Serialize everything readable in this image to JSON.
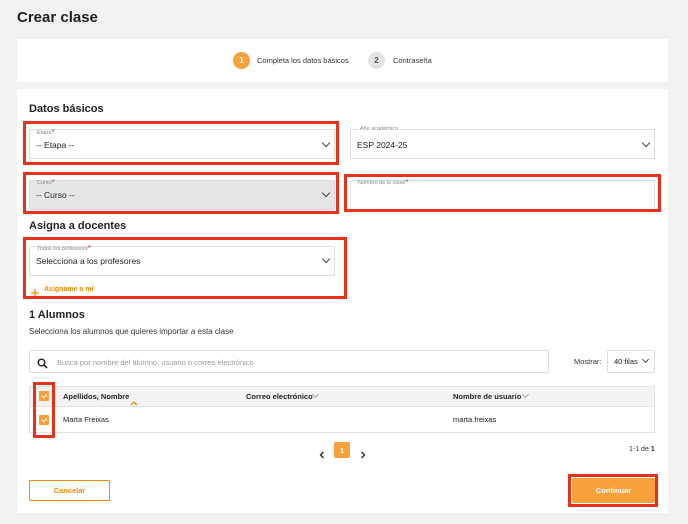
{
  "page": {
    "title": "Crear clase"
  },
  "stepper": {
    "step1": {
      "number": "1",
      "label": "Completa los datos básicos"
    },
    "step2": {
      "number": "2",
      "label": "Contraseña"
    }
  },
  "basic": {
    "title": "Datos básicos",
    "etapa": {
      "label": "Etapa",
      "value": "-- Etapa --"
    },
    "anio": {
      "label": "Año académico",
      "value": "ESP 2024-25"
    },
    "curso": {
      "label": "Curso",
      "value": "-- Curso --"
    },
    "nombre": {
      "label": "Nombre de la clase",
      "value": ""
    }
  },
  "teachers": {
    "title": "Asigna a docentes",
    "field_label": "Todos los profesores",
    "field_value": "Selecciona a los profesores",
    "assign_me": "Asígname a mí"
  },
  "students": {
    "title": "1 Alumnos",
    "subtitle": "Selecciona los alumnos que quieres importar a esta clase",
    "search_placeholder": "Busca por nombre del alumno, usuario o correo electrónico",
    "show_label": "Mostrar:",
    "rows_option": "40 filas",
    "columns": [
      "Apellidos, Nombre",
      "Correo electrónico",
      "Nombre de usuario"
    ],
    "rows": [
      {
        "name": "Marta Freixas",
        "email": "",
        "username": "marta.freixas"
      }
    ],
    "page_current": "1",
    "range_text": "1-1 de",
    "range_total": "1"
  },
  "actions": {
    "cancel": "Cancelar",
    "continue": "Continuar"
  },
  "colors": {
    "accent": "#f7a13a",
    "highlight": "#e8311a",
    "required": "#e03a22"
  }
}
